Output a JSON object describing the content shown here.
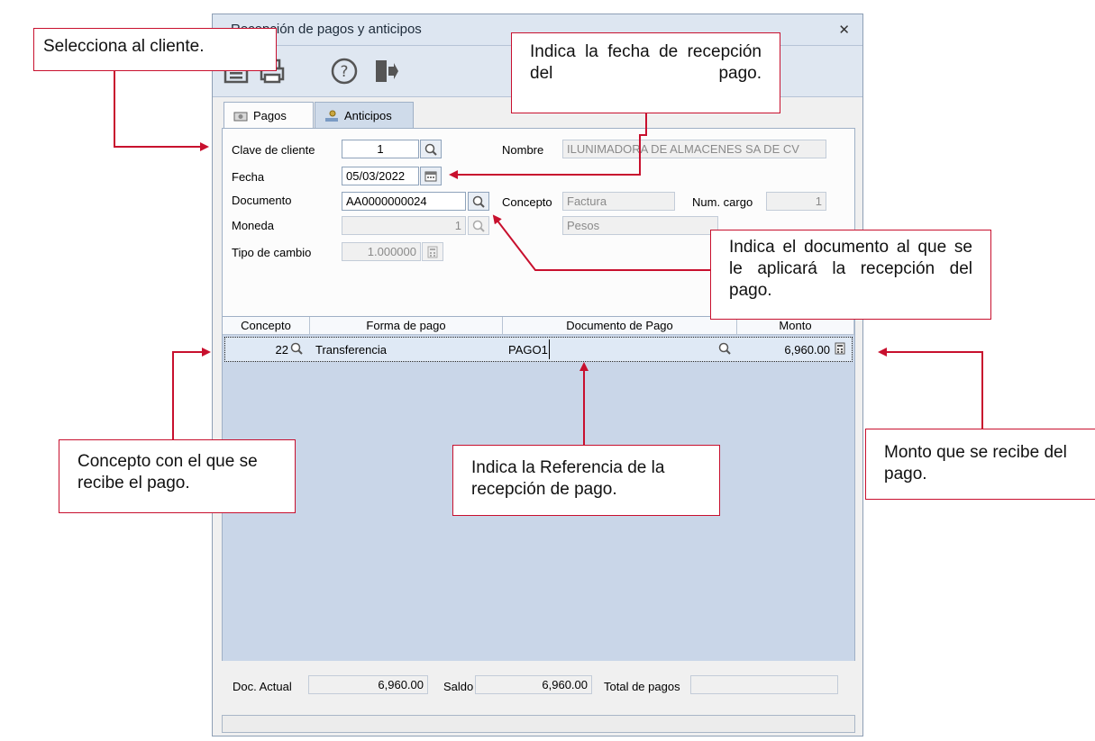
{
  "window": {
    "title": "Recepción de pagos y anticipos",
    "close_label": "✕"
  },
  "toolbar": {
    "icons": [
      "save-icon",
      "print-icon",
      "help-icon",
      "exit-icon"
    ]
  },
  "tabs": [
    {
      "label": "Pagos"
    },
    {
      "label": "Anticipos"
    }
  ],
  "form": {
    "clave_cliente_label": "Clave de cliente",
    "clave_cliente_value": "1",
    "nombre_label": "Nombre",
    "nombre_value": "ILUNIMADORA DE ALMACENES SA DE CV",
    "fecha_label": "Fecha",
    "fecha_value": "05/03/2022",
    "documento_label": "Documento",
    "documento_value": "AA0000000024",
    "concepto_label": "Concepto",
    "concepto_value": "Factura",
    "num_cargo_label": "Num. cargo",
    "num_cargo_value": "1",
    "moneda_label": "Moneda",
    "moneda_value": "1",
    "moneda_name": "Pesos",
    "tipo_cambio_label": "Tipo de cambio",
    "tipo_cambio_value": "1.000000"
  },
  "grid": {
    "columns": [
      "Concepto",
      "Forma de pago",
      "Documento de Pago",
      "Monto"
    ],
    "rows": [
      {
        "concepto": "22",
        "forma_pago": "Transferencia",
        "documento_pago": "PAGO1",
        "monto": "6,960.00"
      }
    ]
  },
  "totals": {
    "doc_actual_label": "Doc. Actual",
    "doc_actual_value": "6,960.00",
    "saldo_label": "Saldo",
    "saldo_value": "6,960.00",
    "total_pagos_label": "Total de pagos",
    "total_pagos_value": ""
  },
  "annotations": {
    "cliente": "Selecciona al cliente.",
    "fecha": "Indica la fecha de recepción del pago.",
    "documento": "Indica el documento al que se le aplicará la recepción del pago.",
    "concepto": "Concepto con el que se recibe el pago.",
    "referencia": "Indica la Referencia de la recepción de pago.",
    "monto": "Monto que se recibe del pago."
  },
  "colors": {
    "annotation_red": "#c8102e",
    "grid_bg": "#c9d6e8",
    "titlebar": "#dde6f1"
  }
}
